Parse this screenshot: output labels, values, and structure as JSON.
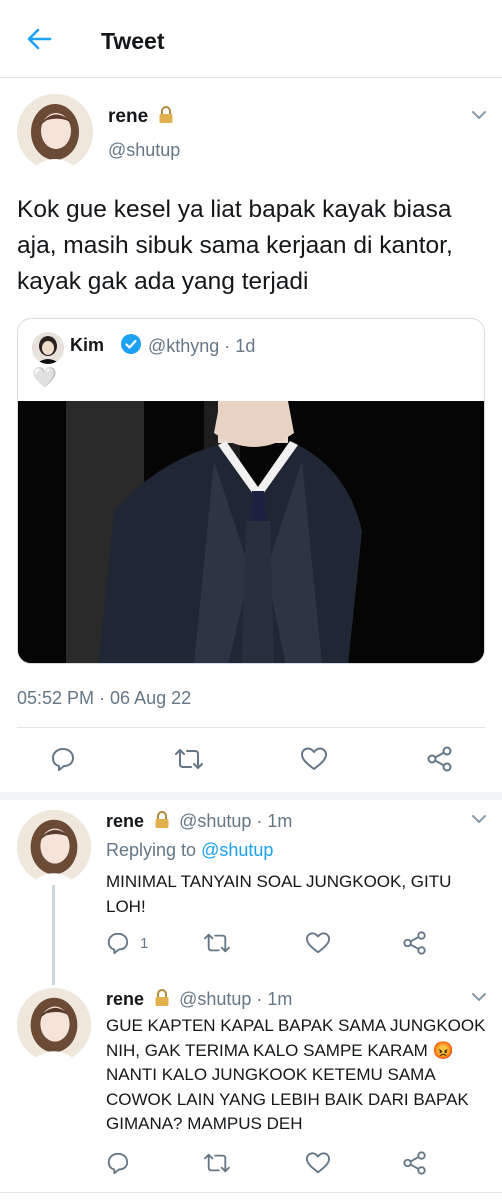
{
  "header": {
    "title": "Tweet",
    "back_icon": "arrow-left-icon",
    "accent": "#1da1f2"
  },
  "tweet": {
    "display_name": "rene",
    "handle": "@shutup",
    "lock_icon": "lock-icon",
    "text": "Kok gue kesel ya liat bapak kayak biasa aja, masih sibuk sama kerjaan di kantor, kayak gak ada yang terjadi",
    "quote": {
      "display_name": "Kim",
      "handle_time": "@kthyng · 1d",
      "verified_icon": "verified-badge-icon",
      "heart": "🤍"
    },
    "timestamp": "05:52 PM · 06 Aug 22",
    "actions": [
      "reply-icon",
      "retweet-icon",
      "like-icon",
      "share-icon"
    ]
  },
  "replies": [
    {
      "display_name": "rene",
      "handle_time": "@shutup · 1m",
      "replying_prefix": "Replying to",
      "replying_handle": "@shutup",
      "text": "MINIMAL TANYAIN SOAL JUNGKOOK, GITU LOH!",
      "reply_count": "1"
    },
    {
      "display_name": "rene",
      "handle_time": "@shutup · 1m",
      "text": "GUE KAPTEN KAPAL BAPAK SAMA JUNGKOOK NIH, GAK TERIMA KALO SAMPE KARAM 😡 NANTI KALO JUNGKOOK KETEMU SAMA COWOK LAIN YANG LEBIH BAIK DARI BAPAK GIMANA? MAMPUS DEH",
      "reply_count": ""
    }
  ],
  "colors": {
    "text": "#14171a",
    "secondary": "#657786",
    "border": "#e1e8ed",
    "link": "#1da1f2"
  }
}
